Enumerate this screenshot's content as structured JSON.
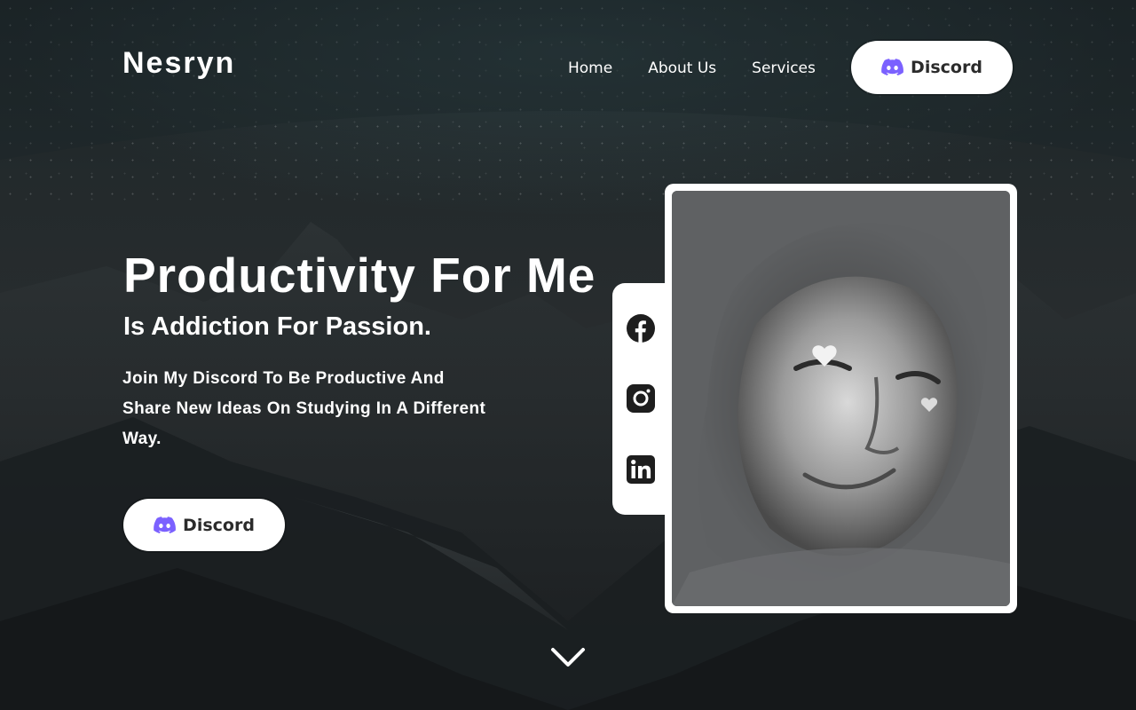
{
  "header": {
    "logo": "Nesryn",
    "nav": [
      {
        "label": "Home"
      },
      {
        "label": "About Us"
      },
      {
        "label": "Services"
      }
    ],
    "discord_label": "Discord"
  },
  "hero": {
    "title": "Productivity For Me",
    "subtitle": "Is Addiction For Passion.",
    "description": "Join My Discord To Be Productive And Share New Ideas On Studying In A Different Way.",
    "discord_label": "Discord"
  },
  "social": [
    {
      "icon": "facebook-icon"
    },
    {
      "icon": "instagram-icon"
    },
    {
      "icon": "linkedin-icon"
    }
  ],
  "colors": {
    "discord_purple": "#7b61ff",
    "button_bg": "#ffffff",
    "button_text": "#2b2b2b",
    "background": "#232a2c"
  }
}
